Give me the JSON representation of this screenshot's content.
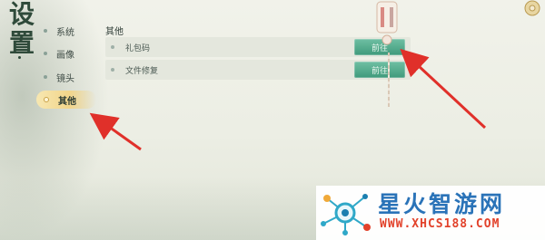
{
  "title": {
    "chars": [
      "设",
      "置"
    ]
  },
  "sidebar": {
    "items": [
      {
        "label": "系统",
        "active": false
      },
      {
        "label": "画像",
        "active": false
      },
      {
        "label": "镜头",
        "active": false
      },
      {
        "label": "其他",
        "active": true
      }
    ]
  },
  "section": {
    "title": "其他"
  },
  "rows": [
    {
      "label": "礼包码",
      "button": "前往"
    },
    {
      "label": "文件修复",
      "button": "前往"
    }
  ],
  "watermark": {
    "brand": "星火智游网",
    "url": "WWW.XHCS188.COM"
  },
  "colors": {
    "accent_green": "#4aa584",
    "active_gold": "#f2d58a",
    "arrow_red": "#e0302a"
  }
}
